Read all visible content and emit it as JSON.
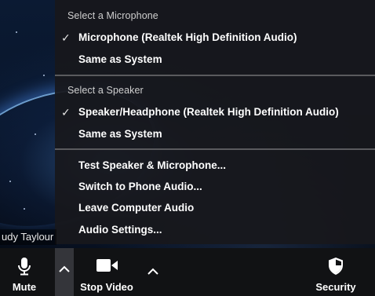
{
  "audio_menu": {
    "microphone_section": {
      "header": "Select a Microphone",
      "items": [
        {
          "label": "Microphone (Realtek High Definition Audio)",
          "selected": true
        },
        {
          "label": "Same as System",
          "selected": false
        }
      ]
    },
    "speaker_section": {
      "header": "Select a Speaker",
      "items": [
        {
          "label": "Speaker/Headphone (Realtek High Definition Audio)",
          "selected": true
        },
        {
          "label": "Same as System",
          "selected": false
        }
      ]
    },
    "actions": [
      "Test Speaker & Microphone...",
      "Switch to Phone Audio...",
      "Leave Computer Audio",
      "Audio Settings..."
    ],
    "check_glyph": "✓"
  },
  "participant": {
    "name": "udy Taylour"
  },
  "toolbar": {
    "mute_label": "Mute",
    "stop_video_label": "Stop Video",
    "security_label": "Security"
  }
}
